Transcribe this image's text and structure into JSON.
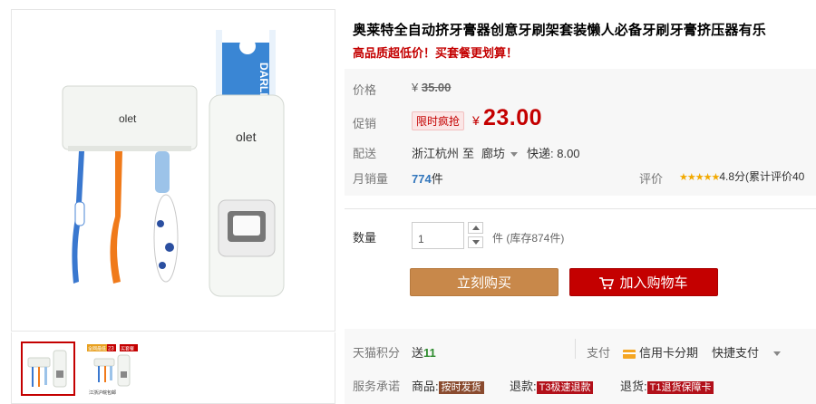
{
  "product": {
    "title": "奥莱特全自动挤牙膏器创意牙刷架套装懒人必备牙刷牙膏挤压器有乐",
    "subtitle": "高品质超低价！买套餐更划算！",
    "brand_on_product": "olet",
    "toothpaste_text": "DARLIE"
  },
  "price": {
    "label": "价格",
    "currency": "¥",
    "original": "35.00"
  },
  "promo": {
    "label": "促销",
    "tag": "限时疯抢",
    "currency": "¥",
    "price": "23.00"
  },
  "delivery": {
    "label": "配送",
    "from": "浙江杭州",
    "to_word": "至",
    "to": "廊坊",
    "express": "快递: 8.00"
  },
  "sales": {
    "label": "月销量",
    "count": "774",
    "unit": "件"
  },
  "rating": {
    "label": "评价",
    "stars": "★★★★★",
    "text": "4.8分(累计评价40"
  },
  "quantity": {
    "label": "数量",
    "value": "1",
    "unit_stock": "件 (库存874件)"
  },
  "actions": {
    "buy_now": "立刻购买",
    "add_cart": "加入购物车"
  },
  "points": {
    "label": "天猫积分",
    "prefix": "送",
    "value": "11"
  },
  "payment": {
    "label": "支付",
    "credit": "信用卡分期",
    "quick": "快捷支付"
  },
  "service": {
    "label": "服务承诺",
    "goods_label": "商品:",
    "goods_badge": "按时发货",
    "refund_label": "退款:",
    "refund_badge": "T3极速退款",
    "return_label": "退货:",
    "return_badge": "T1退货保障卡"
  },
  "thumb2": {
    "badge_left": "全网最低",
    "badge_num": "23",
    "badge_right": "买套餐",
    "caption": "江浙沪皖包邮"
  },
  "colors": {
    "accent_red": "#c40000",
    "buy_now": "#c8884a",
    "link_blue": "#3276bc"
  }
}
